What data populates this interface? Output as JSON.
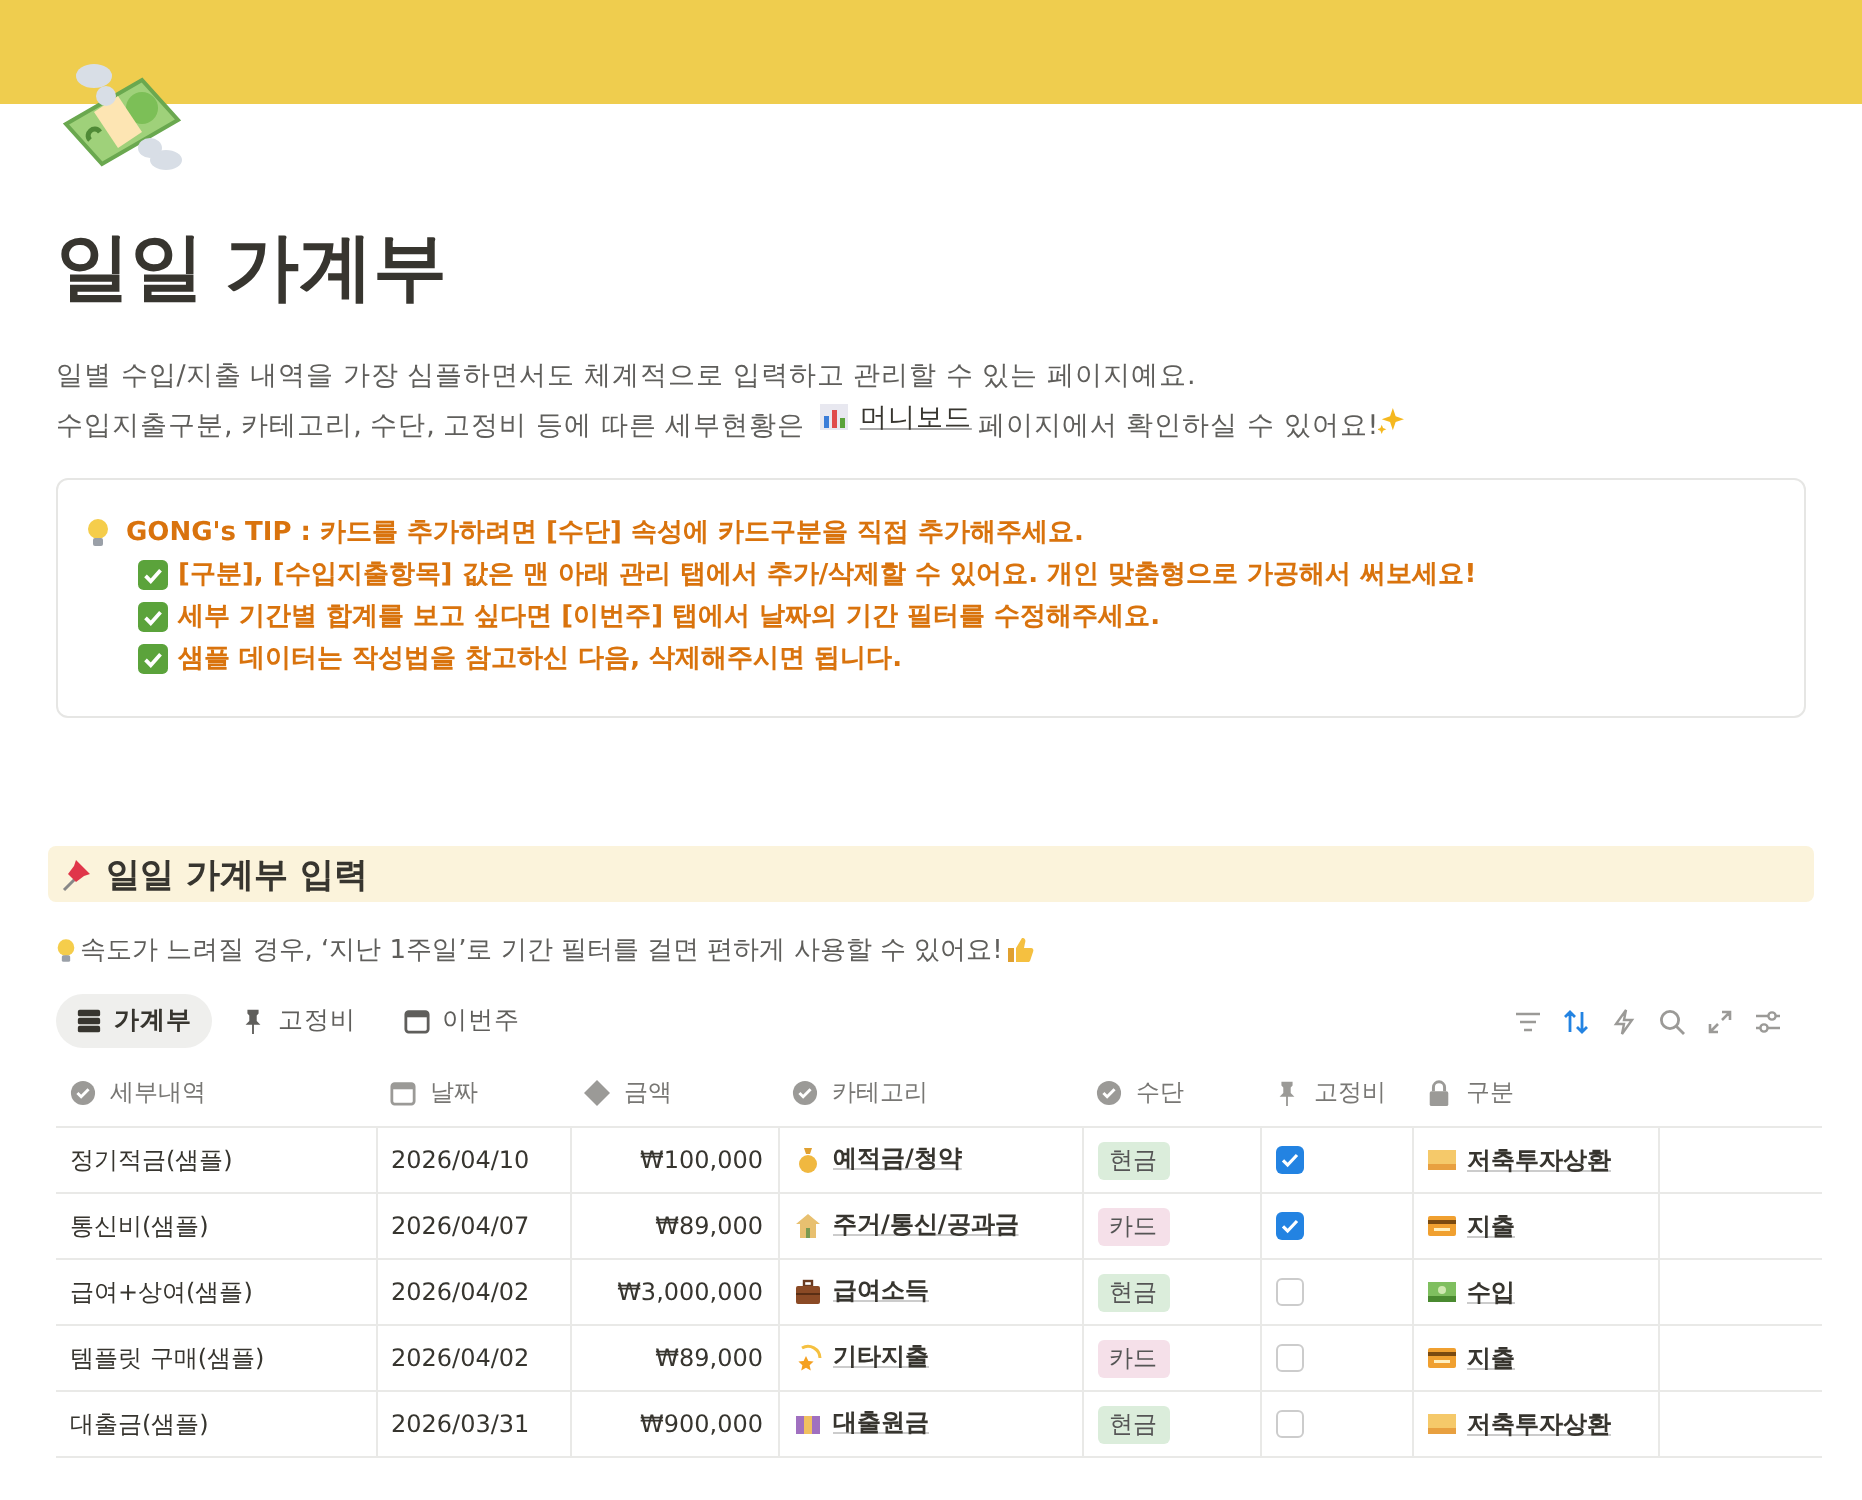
{
  "page": {
    "title": "일일 가계부",
    "description": [
      "일별 수입/지출 내역을 가장 심플하면서도 체계적으로 입력하고 관리할 수 있는 페이지예요.",
      {
        "before": "수입지출구분, 카테고리, 수단, 고정비 등에 따른 세부현황은",
        "link": "머니보드",
        "after": "페이지에서 확인하실 수 있어요!"
      }
    ]
  },
  "callout": {
    "title": "GONG's TIP : 카드를 추가하려면 [수단] 속성에 카드구분을 직접 추가해주세요.",
    "items": [
      "[구분], [수입지출항목] 값은 맨 아래 관리 탭에서 추가/삭제할 수 있어요. 개인 맞춤형으로 가공해서 써보세요!",
      "세부 기간별 합계를 보고 싶다면 [이번주] 탭에서 날짜의 기간 필터를 수정해주세요.",
      "샘플 데이터는 작성법을 참고하신 다음, 삭제해주시면 됩니다."
    ]
  },
  "section": {
    "heading": "일일 가계부 입력",
    "hint": "속도가 느려질 경우, ‘지난 1주일’로 기간 필터를 걸면 편하게 사용할 수 있어요!"
  },
  "tabs": [
    {
      "label": "가계부",
      "selected": true
    },
    {
      "label": "고정비",
      "selected": false
    },
    {
      "label": "이번주",
      "selected": false
    }
  ],
  "table": {
    "columns": [
      "세부내역",
      "날짜",
      "금액",
      "카테고리",
      "수단",
      "고정비",
      "구분"
    ],
    "rows": [
      {
        "detail": "정기적금(샘플)",
        "date": "2026/04/10",
        "amount": "₩100,000",
        "category": "예적금/청약",
        "method": {
          "label": "현금",
          "color": "#dbeddb"
        },
        "fixed": true,
        "class": "저축투자상환"
      },
      {
        "detail": "통신비(샘플)",
        "date": "2026/04/07",
        "amount": "₩89,000",
        "category": "주거/통신/공과금",
        "method": {
          "label": "카드",
          "color": "#f5e0e9"
        },
        "fixed": true,
        "class": "지출"
      },
      {
        "detail": "급여+상여(샘플)",
        "date": "2026/04/02",
        "amount": "₩3,000,000",
        "category": "급여소득",
        "method": {
          "label": "현금",
          "color": "#dbeddb"
        },
        "fixed": false,
        "class": "수입"
      },
      {
        "detail": "템플릿 구매(샘플)",
        "date": "2026/04/02",
        "amount": "₩89,000",
        "category": "기타지출",
        "method": {
          "label": "카드",
          "color": "#f5e0e9"
        },
        "fixed": false,
        "class": "지출"
      },
      {
        "detail": "대출금(샘플)",
        "date": "2026/03/31",
        "amount": "₩900,000",
        "category": "대출원금",
        "method": {
          "label": "현금",
          "color": "#dbeddb"
        },
        "fixed": false,
        "class": "저축투자상환"
      }
    ]
  }
}
